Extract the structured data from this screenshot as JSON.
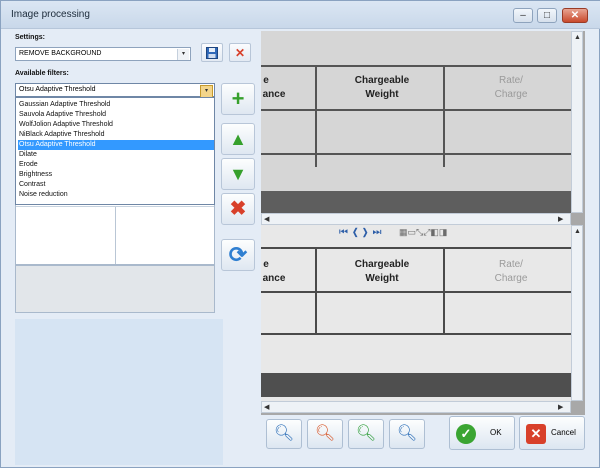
{
  "window": {
    "title": "Image processing",
    "minimize": "–",
    "maximize": "□",
    "close": "✕"
  },
  "settings": {
    "label": "Settings:",
    "value": "REMOVE BACKGROUND",
    "save_icon": "floppy-disk",
    "delete_icon": "x"
  },
  "filters": {
    "label": "Available filters:",
    "selected": "Otsu Adaptive Threshold",
    "options": [
      "Gaussian Adaptive Threshold",
      "Sauvola Adaptive Threshold",
      "WolfJolion Adaptive Threshold",
      "NiBlack Adaptive Threshold",
      "Otsu Adaptive Threshold",
      "Dilate",
      "Erode",
      "Brightness",
      "Contrast",
      "Noise reduction"
    ],
    "highlighted_index": 4
  },
  "side_buttons": {
    "add": "+",
    "up": "▲",
    "down": "▼",
    "remove": "✖",
    "refresh": "⟳"
  },
  "preview": {
    "nav_top": "⏮ ❮ ❯ ⏭",
    "nav_bottom": "⏮ ❮ ❯ ⏭",
    "columns": {
      "left_partial_a": "e",
      "left_partial_b": "ance",
      "chargeable_a": "Chargeable",
      "chargeable_b": "Weight",
      "rate_a": "Rate/",
      "rate_b": "Charge"
    }
  },
  "zoom_buttons": [
    "zoom-fit",
    "zoom-out",
    "zoom-in",
    "zoom-actual"
  ],
  "actions": {
    "ok": "OK",
    "cancel": "Cancel"
  },
  "colors": {
    "accent": "#3399ff",
    "ok_green": "#3aa532",
    "cancel_red": "#d8402a"
  }
}
